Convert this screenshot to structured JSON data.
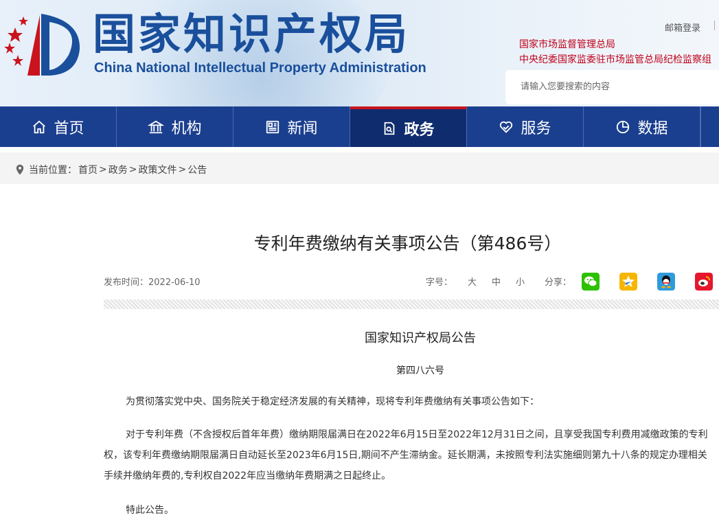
{
  "header": {
    "title_cn": "国家知识产权局",
    "title_en": "China National Intellectual Property Administration",
    "mail_login": "邮箱登录",
    "link_samr": "国家市场监督管理总局",
    "link_discipline": "中央纪委国家监委驻市场监管总局纪检监察组",
    "search_placeholder": "请输入您要搜索的内容"
  },
  "nav": {
    "items": [
      {
        "label": "首页",
        "icon": "home-icon"
      },
      {
        "label": "机构",
        "icon": "institution-icon"
      },
      {
        "label": "新闻",
        "icon": "news-icon"
      },
      {
        "label": "政务",
        "icon": "government-affairs-icon",
        "active": true
      },
      {
        "label": "服务",
        "icon": "service-icon"
      },
      {
        "label": "数据",
        "icon": "data-pie-icon"
      }
    ]
  },
  "breadcrumb": {
    "prefix": "当前位置：",
    "path": [
      "首页",
      "政务",
      "政策文件",
      "公告"
    ],
    "separator": ">"
  },
  "article": {
    "title": "专利年费缴纳有关事项公告（第486号）",
    "publish_label": "发布时间：",
    "publish_date": "2022-06-10",
    "font_size_label": "字号：",
    "font_sizes": [
      "大",
      "中",
      "小"
    ],
    "share_label": "分享：",
    "share_icons": [
      "wechat-icon",
      "qzone-icon",
      "qq-icon",
      "weibo-icon"
    ],
    "heading": "国家知识产权局公告",
    "number": "第四八六号",
    "paragraphs": [
      "为贯彻落实党中央、国务院关于稳定经济发展的有关精神，现将专利年费缴纳有关事项公告如下：",
      "对于专利年费（不含授权后首年年费）缴纳期限届满日在2022年6月15日至2022年12月31日之间，且享受我国专利费用减缴政策的专利权，该专利年费缴纳期限届满日自动延长至2023年6月15日,期间不产生滞纳金。延长期满，未按照专利法实施细则第九十八条的规定办理相关手续并缴纳年费的,专利权自2022年应当缴纳年费期满之日起终止。",
      "特此公告。"
    ]
  },
  "colors": {
    "nav_bg": "#1b3f8f",
    "nav_active": "#0f2c6e",
    "brand_blue": "#1a4f9c",
    "accent_red": "#c9141e",
    "link_red": "#c0001a"
  }
}
